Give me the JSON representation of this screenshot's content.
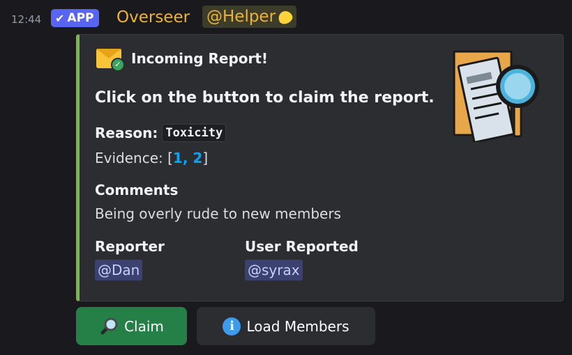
{
  "message": {
    "timestamp": "12:44",
    "app_badge": "APP",
    "author": "Overseer",
    "mention": "@Helper"
  },
  "embed": {
    "author": "Incoming Report!",
    "title": "Click on the button to claim the report.",
    "reason_label": "Reason:",
    "reason_value": "Toxicity",
    "evidence_prefix": "Evidence: [",
    "evidence_links": [
      "1",
      "2"
    ],
    "evidence_sep": ", ",
    "evidence_suffix": "]",
    "comments_label": "Comments",
    "comments_value": "Being overly rude to new members",
    "reporter_label": "Reporter",
    "reporter_value": "@Dan",
    "user_label": "User Reported",
    "user_value": "@syrax",
    "accent_color": "#7ab648"
  },
  "buttons": {
    "claim_label": "Claim",
    "load_label": "Load Members"
  }
}
